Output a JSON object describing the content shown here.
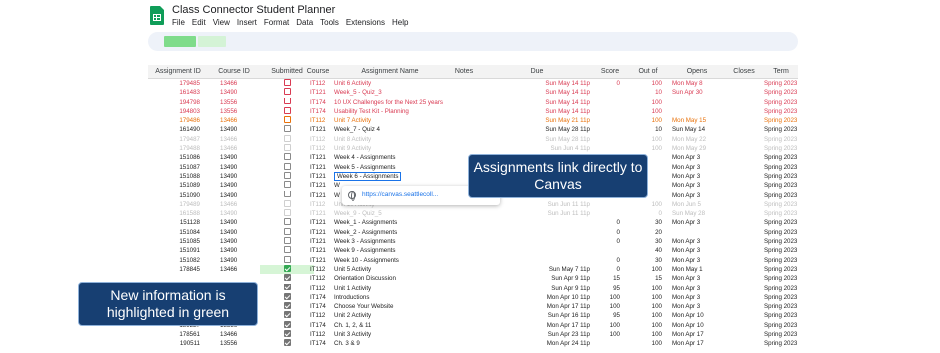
{
  "app": {
    "title": "Class Connector Student Planner",
    "menu": [
      "File",
      "Edit",
      "View",
      "Insert",
      "Format",
      "Data",
      "Tools",
      "Extensions",
      "Help"
    ]
  },
  "headers": [
    "Assignment ID",
    "Course ID",
    "Submitted",
    "Course",
    "Assignment Name",
    "Notes",
    "Due",
    "Score",
    "Out of",
    "Opens",
    "Closes",
    "Term"
  ],
  "rows": [
    {
      "aid": "179485",
      "cid": "13466",
      "sub": "",
      "crs": "IT112",
      "name": "Unit 6 Activity",
      "due": "Sun May 14 11p",
      "score": "0",
      "out": "100",
      "opens": "Mon May 8",
      "closes": "",
      "term": "Spring 2023",
      "status": "overdue"
    },
    {
      "aid": "161483",
      "cid": "13490",
      "sub": "",
      "crs": "IT121",
      "name": "Week_5 - Quiz_3",
      "due": "Sun May 14 11p",
      "score": "",
      "out": "10",
      "opens": "Sun Apr 30",
      "closes": "",
      "term": "Spring 2023",
      "status": "overdue"
    },
    {
      "aid": "194798",
      "cid": "13556",
      "sub": "",
      "crs": "IT174",
      "name": "10 UX Challenges for the Next 25 years",
      "due": "Sun May 14 11p",
      "score": "",
      "out": "100",
      "opens": "",
      "closes": "",
      "term": "Spring 2023",
      "status": "overdue"
    },
    {
      "aid": "194803",
      "cid": "13556",
      "sub": "",
      "crs": "IT174",
      "name": "Usability Test Kit - Planning",
      "due": "Sun May 14 11p",
      "score": "",
      "out": "100",
      "opens": "",
      "closes": "",
      "term": "Spring 2023",
      "status": "overdue"
    },
    {
      "aid": "179486",
      "cid": "13466",
      "sub": "",
      "crs": "IT112",
      "name": "Unit 7 Activity",
      "due": "Sun May 21 11p",
      "score": "",
      "out": "100",
      "opens": "Mon May 15",
      "closes": "",
      "term": "Spring 2023",
      "status": "soon"
    },
    {
      "aid": "161490",
      "cid": "13490",
      "sub": "",
      "crs": "IT121",
      "name": "Week_7 - Quiz 4",
      "due": "Sun May 28 11p",
      "score": "",
      "out": "10",
      "opens": "Sun May 14",
      "closes": "",
      "term": "Spring 2023",
      "status": ""
    },
    {
      "aid": "179487",
      "cid": "13466",
      "sub": "",
      "crs": "IT112",
      "name": "Unit 8 Activity",
      "due": "Sun May 28 11p",
      "score": "",
      "out": "100",
      "opens": "Mon May 22",
      "closes": "",
      "term": "Spring 2023",
      "status": "muted"
    },
    {
      "aid": "179488",
      "cid": "13466",
      "sub": "",
      "crs": "IT112",
      "name": "Unit 9 Activity",
      "due": "Sun Jun 4 11p",
      "score": "",
      "out": "100",
      "opens": "Mon May 29",
      "closes": "",
      "term": "Spring 2023",
      "status": "muted"
    },
    {
      "aid": "151086",
      "cid": "13490",
      "sub": "",
      "crs": "IT121",
      "name": "Week 4 - Assignments",
      "due": "",
      "score": "",
      "out": "",
      "opens": "Mon Apr 3",
      "closes": "",
      "term": "Spring 2023",
      "status": ""
    },
    {
      "aid": "151087",
      "cid": "13490",
      "sub": "",
      "crs": "IT121",
      "name": "Week 5 - Assignments",
      "due": "",
      "score": "",
      "out": "",
      "opens": "Mon Apr 3",
      "closes": "",
      "term": "Spring 2023",
      "status": ""
    },
    {
      "aid": "151088",
      "cid": "13490",
      "sub": "",
      "crs": "IT121",
      "name": "Week 6 - Assignments",
      "due": "",
      "score": "",
      "out": "",
      "opens": "Mon Apr 3",
      "closes": "",
      "term": "Spring 2023",
      "status": "",
      "selected": true
    },
    {
      "aid": "151089",
      "cid": "13490",
      "sub": "",
      "crs": "IT121",
      "name": "W",
      "due": "",
      "score": "",
      "out": "",
      "opens": "Mon Apr 3",
      "closes": "",
      "term": "Spring 2023",
      "status": ""
    },
    {
      "aid": "151090",
      "cid": "13490",
      "sub": "",
      "crs": "IT121",
      "name": "W",
      "due": "",
      "score": "",
      "out": "",
      "opens": "Mon Apr 3",
      "closes": "",
      "term": "Spring 2023",
      "status": ""
    },
    {
      "aid": "179489",
      "cid": "13466",
      "sub": "",
      "crs": "IT112",
      "name": "Unit 10 Activity",
      "due": "Sun Jun 11 11p",
      "score": "",
      "out": "100",
      "opens": "Mon Jun 5",
      "closes": "",
      "term": "Spring 2023",
      "status": "muted"
    },
    {
      "aid": "161588",
      "cid": "13490",
      "sub": "",
      "crs": "IT121",
      "name": "Week_9 - Quiz_5",
      "due": "Sun Jun 11 11p",
      "score": "",
      "out": "0",
      "opens": "Sun May 28",
      "closes": "",
      "term": "Spring 2023",
      "status": "muted"
    },
    {
      "aid": "151128",
      "cid": "13490",
      "sub": "",
      "crs": "IT121",
      "name": "Week_1 - Assignments",
      "due": "",
      "score": "0",
      "out": "30",
      "opens": "Mon Apr 3",
      "closes": "",
      "term": "Spring 2023",
      "status": ""
    },
    {
      "aid": "151084",
      "cid": "13490",
      "sub": "",
      "crs": "IT121",
      "name": "Week_2 - Assignments",
      "due": "",
      "score": "0",
      "out": "20",
      "opens": "",
      "closes": "",
      "term": "Spring 2023",
      "status": ""
    },
    {
      "aid": "151085",
      "cid": "13490",
      "sub": "",
      "crs": "IT121",
      "name": "Week 3 - Assignments",
      "due": "",
      "score": "0",
      "out": "30",
      "opens": "Mon Apr 3",
      "closes": "",
      "term": "Spring 2023",
      "status": ""
    },
    {
      "aid": "151091",
      "cid": "13490",
      "sub": "",
      "crs": "IT121",
      "name": "Week 9 - Assignments",
      "due": "",
      "score": "",
      "out": "40",
      "opens": "Mon Apr 3",
      "closes": "",
      "term": "Spring 2023",
      "status": ""
    },
    {
      "aid": "151082",
      "cid": "13490",
      "sub": "",
      "crs": "IT121",
      "name": "Week 10 - Assignments",
      "due": "",
      "score": "0",
      "out": "30",
      "opens": "Mon Apr 3",
      "closes": "",
      "term": "Spring 2023",
      "status": ""
    },
    {
      "aid": "178845",
      "cid": "13466",
      "sub": "checked-green",
      "crs": "IT112",
      "name": "Unit 5 Activity",
      "due": "Sun May 7 11p",
      "score": "0",
      "out": "100",
      "opens": "Mon May 1",
      "closes": "",
      "term": "Spring 2023",
      "status": "",
      "highlight": true
    },
    {
      "aid": "",
      "cid": "",
      "sub": "checked",
      "crs": "IT112",
      "name": "Orientation Discussion",
      "due": "Sun Apr 9 11p",
      "score": "15",
      "out": "15",
      "opens": "Mon Apr 3",
      "closes": "",
      "term": "Spring 2023",
      "status": ""
    },
    {
      "aid": "",
      "cid": "",
      "sub": "checked",
      "crs": "IT112",
      "name": "Unit 1 Activity",
      "due": "Sun Apr 9 11p",
      "score": "95",
      "out": "100",
      "opens": "Mon Apr 3",
      "closes": "",
      "term": "Spring 2023",
      "status": ""
    },
    {
      "aid": "",
      "cid": "",
      "sub": "checked",
      "crs": "IT174",
      "name": "Introductions",
      "due": "Mon Apr 10 11p",
      "score": "100",
      "out": "100",
      "opens": "Mon Apr 3",
      "closes": "",
      "term": "Spring 2023",
      "status": ""
    },
    {
      "aid": "",
      "cid": "",
      "sub": "checked",
      "crs": "IT174",
      "name": "Choose Your Website",
      "due": "Mon Apr 17 11p",
      "score": "100",
      "out": "100",
      "opens": "Mon Apr 3",
      "closes": "",
      "term": "Spring 2023",
      "status": ""
    },
    {
      "aid": "",
      "cid": "",
      "sub": "checked",
      "crs": "IT112",
      "name": "Unit 2 Activity",
      "due": "Sun Apr 16 11p",
      "score": "95",
      "out": "100",
      "opens": "Mon Apr 10",
      "closes": "",
      "term": "Spring 2023",
      "status": ""
    },
    {
      "aid": "189227",
      "cid": "13556",
      "sub": "checked",
      "crs": "IT174",
      "name": "Ch. 1, 2, & 11",
      "due": "Mon Apr 17 11p",
      "score": "100",
      "out": "100",
      "opens": "Mon Apr 10",
      "closes": "",
      "term": "Spring 2023",
      "status": ""
    },
    {
      "aid": "178561",
      "cid": "13466",
      "sub": "checked",
      "crs": "IT112",
      "name": "Unit 3 Activity",
      "due": "Sun Apr 23 11p",
      "score": "100",
      "out": "100",
      "opens": "Mon Apr 17",
      "closes": "",
      "term": "Spring 2023",
      "status": ""
    },
    {
      "aid": "190511",
      "cid": "13556",
      "sub": "checked",
      "crs": "IT174",
      "name": "Ch. 3 & 9",
      "due": "Mon Apr 24 11p",
      "score": "",
      "out": "100",
      "opens": "Mon Apr 17",
      "closes": "",
      "term": "Spring 2023",
      "status": ""
    }
  ],
  "popup": {
    "url": "https://canvas.seattlecoll..."
  },
  "callouts": {
    "links": "Assignments link directly to Canvas",
    "green": "New information is highlighted in green"
  },
  "colors": {
    "overdue": "#d93a52",
    "due_soon": "#e8710a",
    "future": "#bdbdbd",
    "new_highlight": "#d6f5d6",
    "callout_bg": "#173f72"
  }
}
